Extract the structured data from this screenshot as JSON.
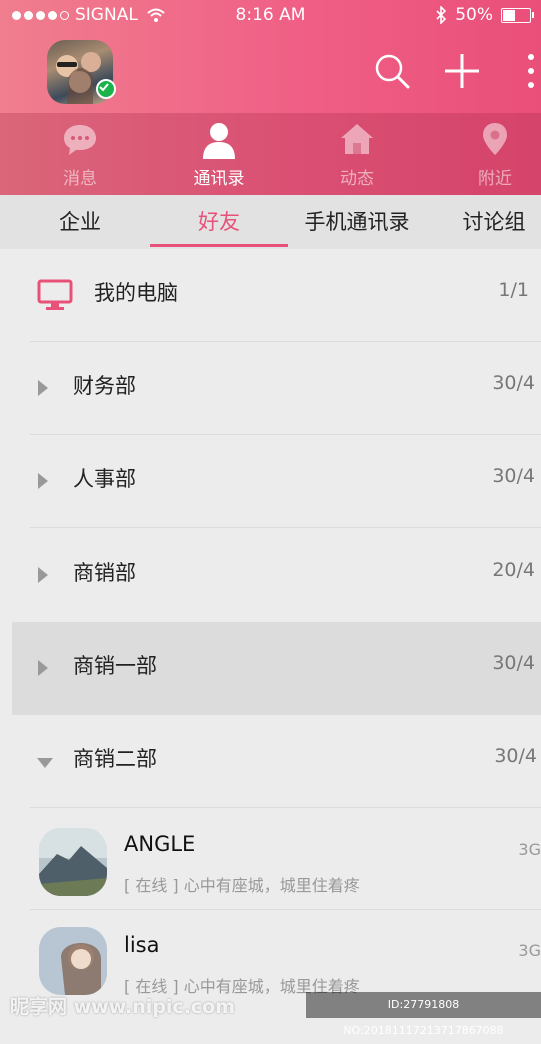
{
  "status_bar": {
    "carrier": "SIGNAL",
    "time": "8:16 AM",
    "battery": "50%",
    "battery_level": 0.5
  },
  "header": {
    "icons": [
      "profile-avatar",
      "search-icon",
      "plus-icon",
      "more-vertical-icon"
    ],
    "nav": [
      {
        "label": "消息",
        "icon": "chat-bubble-icon",
        "active": false
      },
      {
        "label": "通讯录",
        "icon": "person-icon",
        "active": true
      },
      {
        "label": "动态",
        "icon": "home-icon",
        "active": false
      },
      {
        "label": "附近",
        "icon": "location-pin-icon",
        "active": false
      }
    ]
  },
  "subtabs": [
    {
      "label": "企业",
      "active": false
    },
    {
      "label": "好友",
      "active": true
    },
    {
      "label": "手机通讯录",
      "active": false
    },
    {
      "label": "讨论组",
      "active": false
    }
  ],
  "my_computer": {
    "label": "我的电脑",
    "count": "1/1"
  },
  "groups": [
    {
      "label": "财务部",
      "count": "30/4",
      "expanded": false
    },
    {
      "label": "人事部",
      "count": "30/4",
      "expanded": false
    },
    {
      "label": "商销部",
      "count": "20/4",
      "expanded": false
    },
    {
      "label": "商销一部",
      "count": "30/4",
      "expanded": false,
      "highlighted": true
    },
    {
      "label": "商销二部",
      "count": "30/4",
      "expanded": true
    }
  ],
  "contacts": [
    {
      "name": "ANGLE",
      "status": "[ 在线 ] 心中有座城，城里住着疼",
      "network": "3G"
    },
    {
      "name": "lisa",
      "status": "[ 在线 ] 心中有座城，城里住着疼",
      "network": "3G"
    }
  ],
  "watermark": {
    "left": "昵享网 www.nipic.com",
    "right": "ID:27791808 NO:20181117213717867088"
  },
  "colors": {
    "accent": "#e8527a",
    "header_start": "#f07e8e",
    "header_end": "#e94f79"
  }
}
